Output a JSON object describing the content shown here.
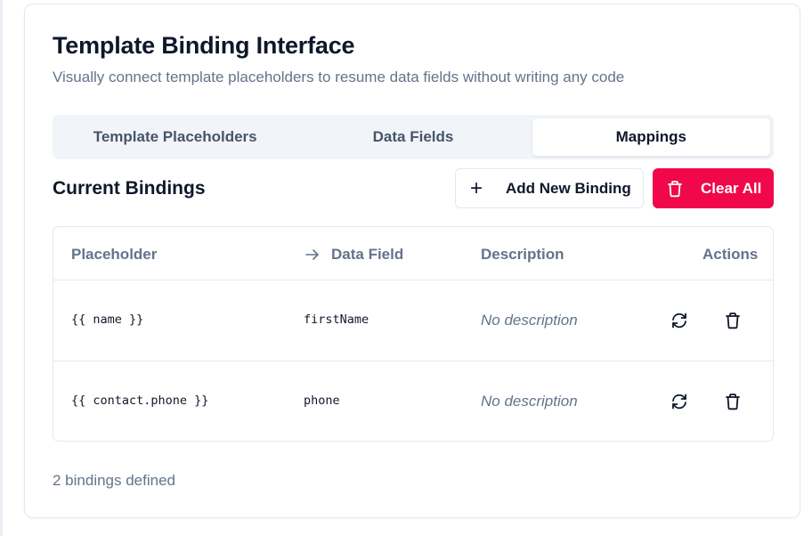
{
  "card": {
    "title": "Template Binding Interface",
    "subtitle": "Visually connect template placeholders to resume data fields without writing any code"
  },
  "tabs": [
    {
      "label": "Template Placeholders",
      "active": false
    },
    {
      "label": "Data Fields",
      "active": false
    },
    {
      "label": "Mappings",
      "active": true
    }
  ],
  "section": {
    "title": "Current Bindings",
    "add_label": "Add New Binding",
    "clear_label": "Clear All"
  },
  "table": {
    "headers": {
      "placeholder": "Placeholder",
      "data_field": "Data Field",
      "description": "Description",
      "actions": "Actions"
    },
    "rows": [
      {
        "placeholder": "{{ name }}",
        "data_field": "firstName",
        "description": "No description"
      },
      {
        "placeholder": "{{ contact.phone }}",
        "data_field": "phone",
        "description": "No description"
      }
    ]
  },
  "footer": {
    "count_text": "2 bindings defined"
  },
  "colors": {
    "danger": "#f0084a",
    "muted_text": "#64748b",
    "border": "#e2e8f0",
    "tab_bg": "#f1f5f9"
  },
  "icons": {
    "add": "plus-icon",
    "clear": "trash-icon",
    "arrow": "arrow-right-icon",
    "refresh": "refresh-icon",
    "delete": "trash-icon"
  }
}
